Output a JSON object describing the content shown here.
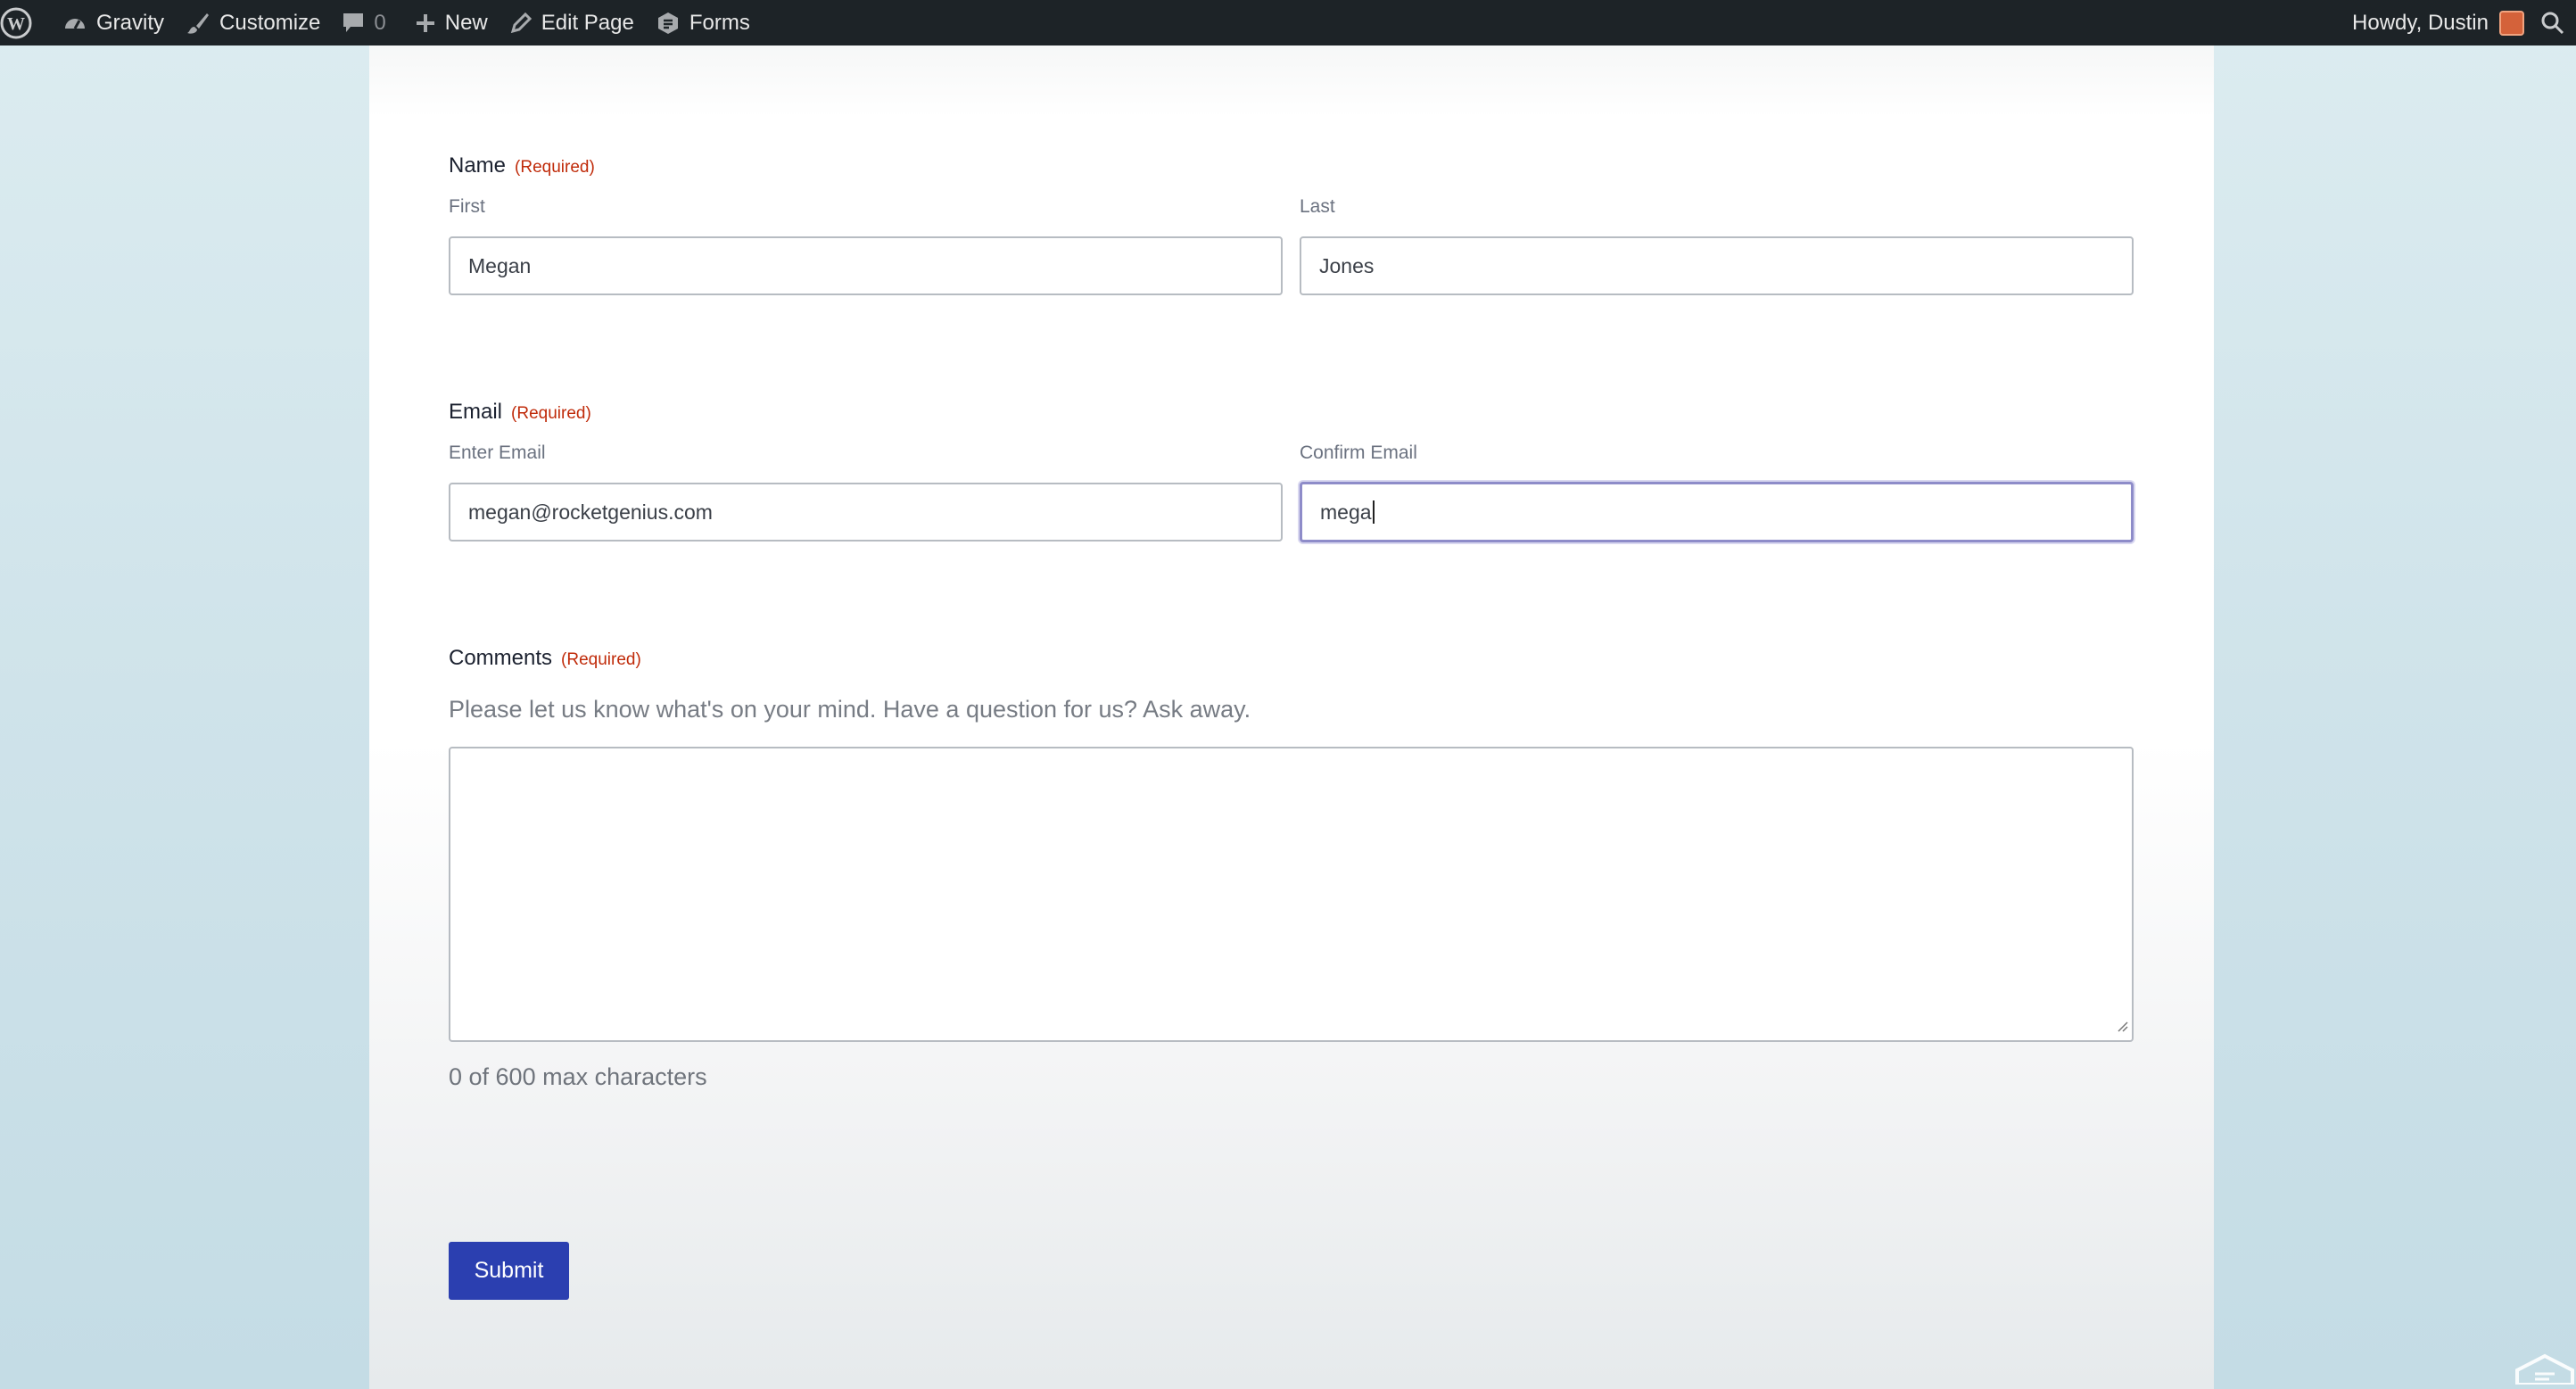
{
  "adminbar": {
    "site_name": "Gravity",
    "customize": "Customize",
    "comments_count": "0",
    "new": "New",
    "edit_page": "Edit Page",
    "forms": "Forms",
    "greeting": "Howdy, Dustin"
  },
  "form": {
    "name": {
      "label": "Name",
      "required": "(Required)",
      "first_label": "First",
      "first_value": "Megan",
      "last_label": "Last",
      "last_value": "Jones"
    },
    "email": {
      "label": "Email",
      "required": "(Required)",
      "enter_label": "Enter Email",
      "enter_value": "megan@rocketgenius.com",
      "confirm_label": "Confirm Email",
      "confirm_value": "mega"
    },
    "comments": {
      "label": "Comments",
      "required": "(Required)",
      "description": "Please let us know what's on your mind. Have a question for us? Ask away.",
      "value": "",
      "counter": "0 of 600 max characters"
    },
    "submit_label": "Submit"
  },
  "colors": {
    "adminbar_bg": "#1d2327",
    "required": "#c02b0a",
    "submit_bg": "#2b3fb0",
    "focus_border": "#8e8cc9"
  }
}
